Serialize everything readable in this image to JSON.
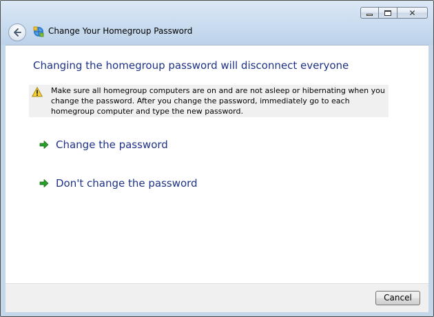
{
  "window": {
    "title": "Change Your Homegroup Password",
    "caption": {
      "minimize_icon": "minimize-icon",
      "maximize_icon": "maximize-icon",
      "close_icon": "close-icon"
    },
    "back_icon": "back-arrow-icon",
    "app_icon": "homegroup-icon"
  },
  "main": {
    "heading": "Changing the homegroup password will disconnect everyone",
    "warning": {
      "icon": "warning-icon",
      "text": "Make sure all homegroup computers are on and are not asleep or hibernating when you change the password. After you change the password, immediately go to each homegroup computer and type the new password."
    },
    "options": [
      {
        "label": "Change the password",
        "icon": "green-arrow-icon"
      },
      {
        "label": "Don't change the password",
        "icon": "green-arrow-icon"
      }
    ]
  },
  "footer": {
    "cancel_label": "Cancel"
  },
  "colors": {
    "heading": "#1e3287",
    "link": "#1e3287",
    "frame": "#c3d6ea",
    "warning_bg": "#f0f0f0",
    "arrow": "#2a9d2a"
  }
}
